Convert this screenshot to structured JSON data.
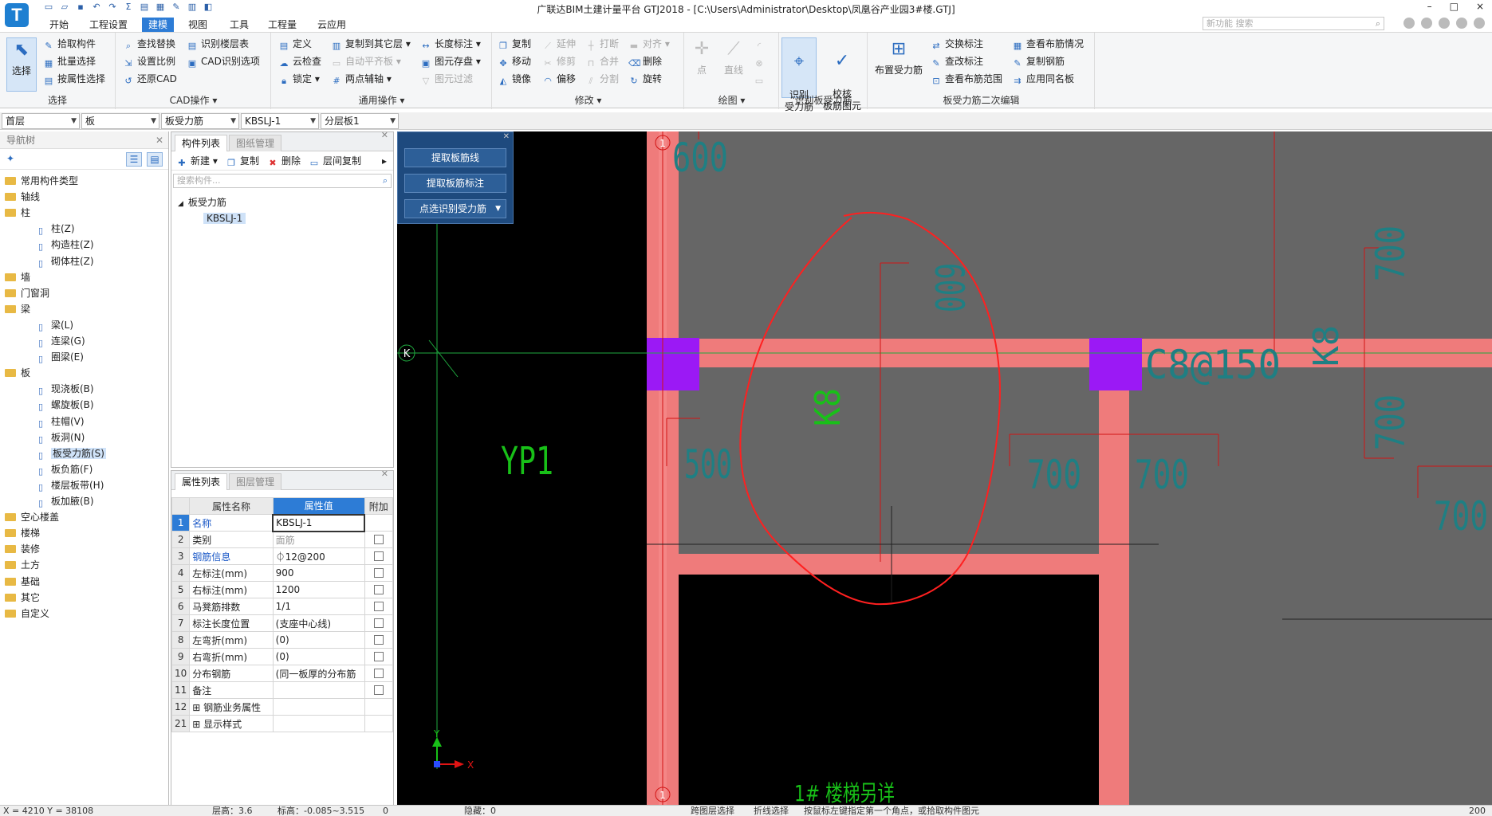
{
  "window": {
    "app_logo": "T",
    "title": "广联达BIM土建计量平台 GTJ2018 - [C:\\Users\\Administrator\\Desktop\\凤凰谷产业园3#楼.GTJ]",
    "controls": [
      "–",
      "□",
      "×"
    ]
  },
  "menu": {
    "tabs": [
      "开始",
      "工程设置",
      "建模",
      "视图",
      "工具",
      "工程量",
      "云应用"
    ],
    "active": "建模",
    "search_placeholder": "新功能 搜索"
  },
  "ribbon": {
    "select_group": {
      "label": "选择",
      "big_button": "选择",
      "items": [
        "拾取构件",
        "批量选择",
        "按属性选择"
      ]
    },
    "cad_group": {
      "label": "CAD操作",
      "items": [
        "查找替换",
        "识别楼层表",
        "设置比例",
        "CAD识别选项",
        "还原CAD"
      ]
    },
    "common_group": {
      "label": "通用操作",
      "items": [
        "定义",
        "复制到其它层",
        "长度标注",
        "云检查",
        "自动平齐板",
        "图元存盘",
        "锁定",
        "两点辅轴",
        "图元过滤"
      ]
    },
    "modify_group": {
      "label": "修改",
      "items": [
        "复制",
        "延伸",
        "打断",
        "对齐",
        "移动",
        "修剪",
        "合并",
        "删除",
        "镜像",
        "偏移",
        "分割",
        "旋转"
      ]
    },
    "draw_group": {
      "label": "绘图",
      "items": [
        "点",
        "直线"
      ]
    },
    "identify_group": {
      "label": "识别板受力筋",
      "items": [
        "识别\n受力筋",
        "校核\n板筋图元"
      ]
    },
    "edit_group": {
      "label": "板受力筋二次编辑",
      "big_button": "布置受力筋",
      "items": [
        "交换标注",
        "查看布筋情况",
        "查改标注",
        "复制钢筋",
        "查看布筋范围",
        "应用同名板"
      ]
    }
  },
  "filters": [
    "首层",
    "板",
    "板受力筋",
    "KBSLJ-1",
    "分层板1"
  ],
  "nav_tree": {
    "header": "导航树",
    "items": [
      {
        "label": "常用构件类型",
        "type": "folder"
      },
      {
        "label": "轴线",
        "type": "folder"
      },
      {
        "label": "柱",
        "type": "folder"
      },
      {
        "label": "柱(Z)",
        "type": "leaf"
      },
      {
        "label": "构造柱(Z)",
        "type": "leaf"
      },
      {
        "label": "砌体柱(Z)",
        "type": "leaf"
      },
      {
        "label": "墙",
        "type": "folder"
      },
      {
        "label": "门窗洞",
        "type": "folder"
      },
      {
        "label": "梁",
        "type": "folder"
      },
      {
        "label": "梁(L)",
        "type": "leaf"
      },
      {
        "label": "连梁(G)",
        "type": "leaf"
      },
      {
        "label": "圈梁(E)",
        "type": "leaf"
      },
      {
        "label": "板",
        "type": "folder"
      },
      {
        "label": "现浇板(B)",
        "type": "leaf"
      },
      {
        "label": "螺旋板(B)",
        "type": "leaf"
      },
      {
        "label": "柱帽(V)",
        "type": "leaf"
      },
      {
        "label": "板洞(N)",
        "type": "leaf"
      },
      {
        "label": "板受力筋(S)",
        "type": "leaf"
      },
      {
        "label": "板负筋(F)",
        "type": "leaf"
      },
      {
        "label": "楼层板带(H)",
        "type": "leaf"
      },
      {
        "label": "板加腋(B)",
        "type": "leaf"
      },
      {
        "label": "空心楼盖",
        "type": "folder"
      },
      {
        "label": "楼梯",
        "type": "folder"
      },
      {
        "label": "装修",
        "type": "folder"
      },
      {
        "label": "土方",
        "type": "folder"
      },
      {
        "label": "基础",
        "type": "folder"
      },
      {
        "label": "其它",
        "type": "folder"
      },
      {
        "label": "自定义",
        "type": "folder"
      }
    ],
    "selected": "板受力筋(S)"
  },
  "component_list": {
    "tabs": [
      "构件列表",
      "图纸管理"
    ],
    "toolbar": [
      "新建",
      "复制",
      "删除",
      "层间复制"
    ],
    "search_placeholder": "搜索构件...",
    "group": "板受力筋",
    "item": "KBSLJ-1"
  },
  "properties": {
    "tabs": [
      "属性列表",
      "图层管理"
    ],
    "headers": [
      "属性名称",
      "属性值",
      "附加"
    ],
    "rows": [
      {
        "no": "1",
        "name": "名称",
        "value": "KBSLJ-1",
        "link": true,
        "check": false
      },
      {
        "no": "2",
        "name": "类别",
        "value": "面筋",
        "gray": true,
        "check": true
      },
      {
        "no": "3",
        "name": "钢筋信息",
        "value": "⏀12@200",
        "link": true,
        "check": true
      },
      {
        "no": "4",
        "name": "左标注(mm)",
        "value": "900",
        "check": true
      },
      {
        "no": "5",
        "name": "右标注(mm)",
        "value": "1200",
        "check": true
      },
      {
        "no": "6",
        "name": "马凳筋排数",
        "value": "1/1",
        "check": true
      },
      {
        "no": "7",
        "name": "标注长度位置",
        "value": "(支座中心线)",
        "check": true
      },
      {
        "no": "8",
        "name": "左弯折(mm)",
        "value": "(0)",
        "check": true
      },
      {
        "no": "9",
        "name": "右弯折(mm)",
        "value": "(0)",
        "check": true
      },
      {
        "no": "10",
        "name": "分布钢筋",
        "value": "(同一板厚的分布筋",
        "check": true
      },
      {
        "no": "11",
        "name": "备注",
        "value": "",
        "check": true
      },
      {
        "no": "12",
        "name": "钢筋业务属性",
        "value": "",
        "expand": true,
        "check": false
      },
      {
        "no": "21",
        "name": "显示样式",
        "value": "",
        "expand": true,
        "check": false
      }
    ]
  },
  "float_panel": {
    "buttons": [
      "提取板筋线",
      "提取板筋标注",
      "点选识别受力筋"
    ]
  },
  "canvas": {
    "labels": {
      "axis_1_top": "1",
      "axis_1_bottom": "1",
      "axis_k": "K",
      "yp1": "YP1",
      "dim_600_top": "600",
      "dim_600_mid": "600",
      "dim_500": "500",
      "k8_green": "K8",
      "c8_150": "C8@150",
      "k8_cyan": "K8",
      "dim_700_a": "700",
      "dim_700_b": "700",
      "dim_700_right1": "700",
      "dim_700_right2": "700",
      "dim_700_far": "700",
      "stair_note": "1# 楼梯另详",
      "axis_y": "Y",
      "axis_x": "X"
    }
  },
  "status": {
    "coords": "X = 4210 Y = 38108",
    "floor_height": "层高：3.6",
    "elevation": "标高：-0.085~3.515",
    "value0": "0",
    "hidden": "隐藏：0",
    "cross_select": "跨图层选择",
    "polyline_select": "折线选择",
    "hint": "按鼠标左键指定第一个角点，或拾取构件图元",
    "zoom": "200"
  },
  "colors": {
    "accent": "#2d7cd6",
    "beam": "#ef7b7b",
    "column": "#9b19f5",
    "slab_gray": "#666666",
    "markup_red": "#ff2020",
    "cad_text_green": "#18c018",
    "cad_text_cyan": "#1f7f83"
  }
}
